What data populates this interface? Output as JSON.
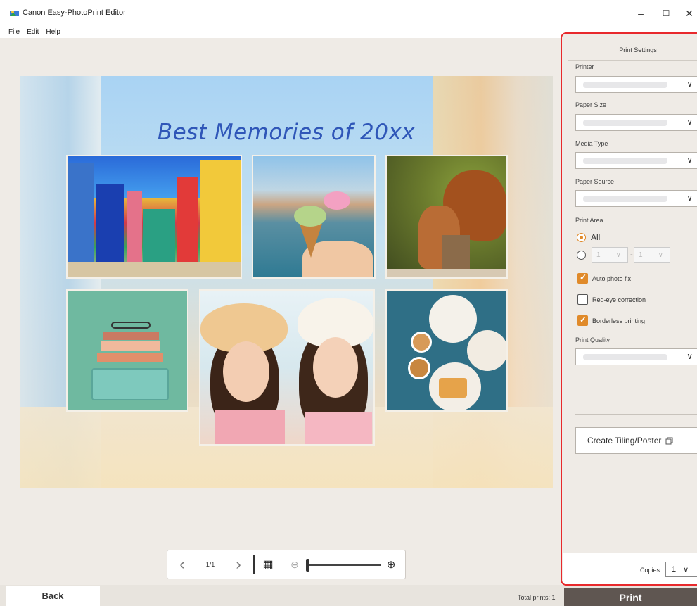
{
  "window": {
    "title": "Canon Easy-PhotoPrint Editor",
    "minimize": "–",
    "maximize": "☐",
    "close": "✕"
  },
  "menu": {
    "file": "File",
    "edit": "Edit",
    "help": "Help"
  },
  "canvas": {
    "headline": "Best Memories of 20xx"
  },
  "toolbar": {
    "prev": "‹",
    "page": "1/1",
    "next": "›",
    "grid_icon": "▦",
    "zoom_out": "⊖",
    "zoom_in": "⊕",
    "zoom_level": 0
  },
  "footer": {
    "back": "Back",
    "total_prints": "Total prints: 1",
    "print": "Print"
  },
  "panel": {
    "title": "Print Settings",
    "printer_label": "Printer",
    "paper_size_label": "Paper Size",
    "media_type_label": "Media Type",
    "paper_source_label": "Paper Source",
    "print_area_label": "Print Area",
    "all_label": "All",
    "range_from": "1",
    "range_to": "1",
    "range_sep": "-",
    "auto_photo_fix": "Auto photo fix",
    "red_eye": "Red-eye correction",
    "borderless": "Borderless printing",
    "print_quality_label": "Print Quality",
    "tiling_button": "Create Tiling/Poster",
    "copies_label": "Copies",
    "copies_value": "1",
    "chevron": "∨"
  },
  "colors": {
    "accent": "#e08a2a",
    "highlight_border": "#e8292c",
    "print_button": "#5f5651"
  }
}
